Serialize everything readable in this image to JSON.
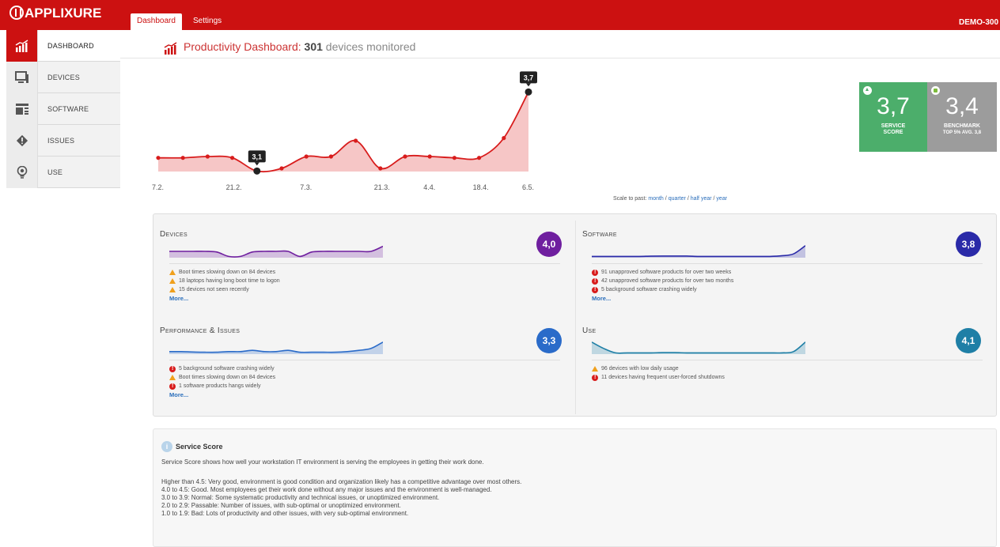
{
  "app": {
    "logo": "APPLIXURE",
    "tenant": "DEMO-300"
  },
  "tabs": [
    {
      "label": "Dashboard"
    },
    {
      "label": "Settings"
    }
  ],
  "sidebar": {
    "items": [
      {
        "label": "DASHBOARD",
        "icon": "chart-icon"
      },
      {
        "label": "DEVICES",
        "icon": "monitor-icon"
      },
      {
        "label": "SOFTWARE",
        "icon": "window-icon"
      },
      {
        "label": "ISSUES",
        "icon": "alert-icon"
      },
      {
        "label": "USE",
        "icon": "bulb-icon"
      }
    ]
  },
  "page": {
    "title_prefix": "Productivity Dashboard:",
    "count": "301",
    "title_suffix": "devices monitored"
  },
  "chart_data": {
    "type": "area",
    "x": [
      "7.2.",
      "",
      "",
      "",
      "21.2.",
      "",
      "",
      "",
      "7.3.",
      "",
      "",
      "",
      "21.3.",
      "",
      "4.4.",
      "",
      "",
      "18.4.",
      "",
      "",
      "6.5."
    ],
    "x_ticks": [
      "7.2.",
      "21.2.",
      "7.3.",
      "21.3.",
      "4.4.",
      "18.4.",
      "6.5."
    ],
    "values": [
      3.2,
      3.2,
      3.21,
      3.2,
      3.1,
      3.12,
      3.21,
      3.21,
      3.33,
      3.12,
      3.21,
      3.21,
      3.2,
      3.2,
      3.35,
      3.7
    ],
    "annotations": [
      {
        "label": "3,1"
      },
      {
        "label": "3,7"
      }
    ],
    "colors": {
      "line": "#d81c1c",
      "fill": "#f6c6c6"
    }
  },
  "scale": {
    "prefix": "Scale to past:",
    "month": "month",
    "quarter": "quarter",
    "half_year": "half year",
    "year": "year"
  },
  "scores": {
    "service": {
      "value": "3,7",
      "label_line1": "SERVICE",
      "label_line2": "SCORE",
      "color": "#4cae6b"
    },
    "benchmark": {
      "value": "3,4",
      "label": "BENCHMARK",
      "sub": "TOP 5% AVG. 3,8",
      "color": "#9c9c9c"
    }
  },
  "categories": [
    {
      "title": "Devices",
      "score": "4,0",
      "color": "#6f1f9f",
      "spark": [
        0.5,
        0.5,
        0.5,
        0.5,
        0.45,
        0.1,
        0.1,
        0.45,
        0.5,
        0.5,
        0.5,
        0.1,
        0.45,
        0.5,
        0.5,
        0.5,
        0.5,
        0.5,
        0.9
      ],
      "items": [
        {
          "level": "warn",
          "text": "Boot times slowing down on 84 devices"
        },
        {
          "level": "warn",
          "text": "18 laptops having long boot time to logon"
        },
        {
          "level": "warn",
          "text": "15 devices not seen recently"
        }
      ],
      "more": "More..."
    },
    {
      "title": "Software",
      "score": "3,8",
      "color": "#2a2aa8",
      "spark": [
        0.1,
        0.1,
        0.1,
        0.1,
        0.1,
        0.12,
        0.13,
        0.13,
        0.13,
        0.1,
        0.1,
        0.1,
        0.1,
        0.1,
        0.1,
        0.1,
        0.15,
        0.3,
        0.95
      ],
      "items": [
        {
          "level": "err",
          "text": "91 unapproved software products for over two weeks"
        },
        {
          "level": "err",
          "text": "42 unapproved software products for over two months"
        },
        {
          "level": "err",
          "text": "5 background software crashing widely"
        }
      ],
      "more": "More..."
    },
    {
      "title": "Performance & Issues",
      "score": "3,3",
      "color": "#2a6bc9",
      "spark": [
        0.2,
        0.2,
        0.17,
        0.15,
        0.15,
        0.2,
        0.2,
        0.3,
        0.2,
        0.2,
        0.3,
        0.15,
        0.15,
        0.15,
        0.15,
        0.2,
        0.3,
        0.45,
        0.95
      ],
      "items": [
        {
          "level": "err",
          "text": "5 background software crashing widely"
        },
        {
          "level": "warn",
          "text": "Boot times slowing down on 84 devices"
        },
        {
          "level": "err",
          "text": "1 software products hangs widely"
        }
      ],
      "more": "More..."
    },
    {
      "title": "Use",
      "score": "4,1",
      "color": "#1f7fa6",
      "spark": [
        0.95,
        0.45,
        0.1,
        0.1,
        0.1,
        0.1,
        0.12,
        0.12,
        0.1,
        0.1,
        0.1,
        0.1,
        0.1,
        0.1,
        0.1,
        0.1,
        0.1,
        0.2,
        0.95
      ],
      "items": [
        {
          "level": "warn",
          "text": "96 devices with low daily usage"
        },
        {
          "level": "err",
          "text": "11 devices having frequent user-forced shutdowns"
        }
      ],
      "more": ""
    }
  ],
  "info": {
    "title": "Service Score",
    "description": "Service Score shows how well your workstation IT environment is serving the employees in getting their work done.",
    "levels": [
      "Higher than 4.5: Very good, environment is good condition and organization likely has a competitive advantage over most others.",
      "4.0 to 4.5: Good. Most employees get their work done without any major issues and the environment is well-managed.",
      "3.0 to 3.9: Normal: Some systematic productivity and technical issues, or unoptimized environment.",
      "2.0 to 2.9: Passable: Number of issues, with sub-optimal or unoptimized environment.",
      "1.0 to 1.9: Bad: Lots of productivity and other issues, with very sub-optimal environment."
    ]
  }
}
